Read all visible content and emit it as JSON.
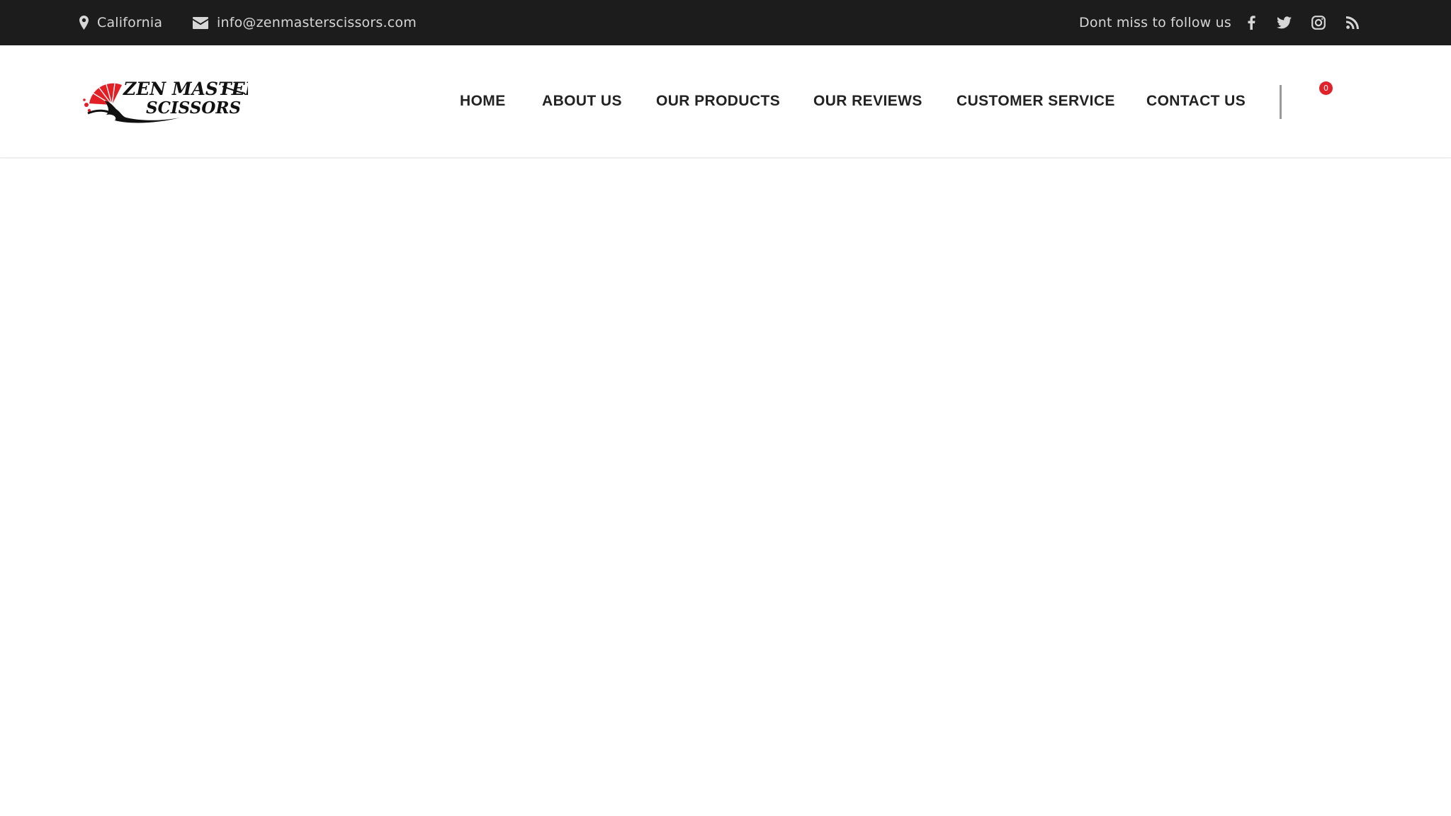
{
  "topbar": {
    "location": "California",
    "location_icon": "map-marker-icon",
    "email": "info@zenmasterscissors.com",
    "email_icon": "envelope-icon",
    "follow_text": "Dont miss to follow us",
    "social": [
      "facebook-icon",
      "twitter-icon",
      "instagram-icon",
      "rss-icon"
    ]
  },
  "header": {
    "logo_alt": "ZEN MASTER SCISSORS",
    "logo_line1": "ZEN MASTER",
    "logo_line2": "SCISSORS",
    "nav": [
      "HOME",
      "ABOUT US",
      "OUR PRODUCTS",
      "OUR REVIEWS",
      "CUSTOMER SERVICE",
      "CONTACT US"
    ],
    "cart_count": "0"
  },
  "colors": {
    "topbar_bg": "#1c1c1c",
    "topbar_text": "#d6d6d6",
    "nav_text": "#222222",
    "accent_red": "#e0222b"
  }
}
